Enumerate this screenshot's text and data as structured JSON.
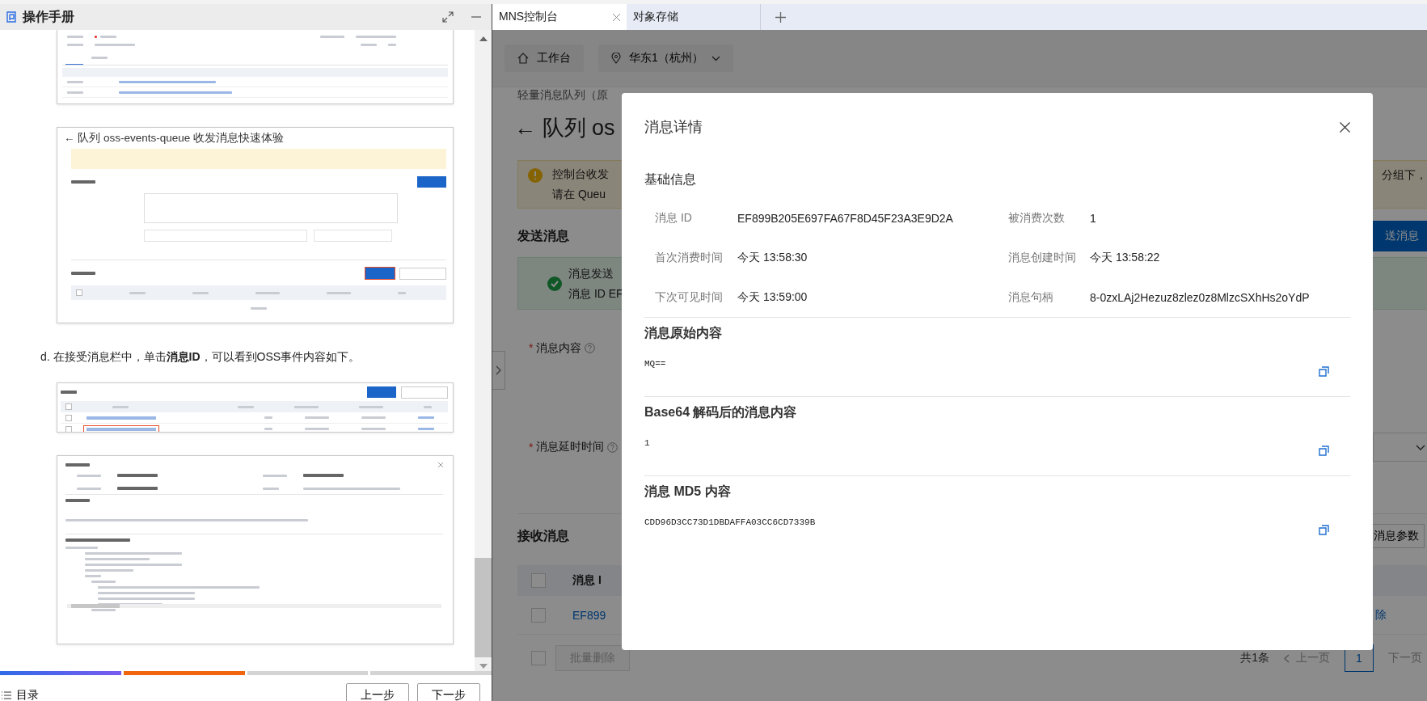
{
  "manual": {
    "title": "操作手册",
    "figure_quick_test": {
      "title": "← 队列 oss-events-queue 收发消息快速体验"
    },
    "paragraph": "d. 在接受消息栏中，单击**消息ID**，可以看到OSS事件内容如下。",
    "figure_receive": {
      "rows": [
        {
          "highlighted": false
        },
        {
          "highlighted": true
        }
      ]
    },
    "progress": [
      {
        "kind": "done"
      },
      {
        "kind": "current"
      },
      {
        "kind": "todo"
      },
      {
        "kind": "todo"
      }
    ],
    "toc": "目录",
    "buttons": [
      "上一步",
      "下一步"
    ]
  },
  "browser_tabs": [
    {
      "label": "MNS控制台",
      "selected": true
    },
    {
      "label": "对象存储",
      "selected": false
    }
  ],
  "toolbar": {
    "home": "工作台",
    "region": "华东1（杭州）"
  },
  "background_page": {
    "breadcrumb": "轻量消息队列（原",
    "heading": "← 队列 os",
    "warning_left": [
      "控制台收发",
      "请在 Queu"
    ],
    "warning_right": "分组下，",
    "send_title": "发送消息",
    "send_button": "送消息",
    "success_lines": [
      "消息发送",
      "消息 ID EF"
    ],
    "content_field": {
      "mark": "*",
      "label": "消息内容"
    },
    "delay_field": {
      "mark": "*",
      "label": "消息延时时间"
    },
    "receive_title": "接收消息",
    "params_button": "消息参数",
    "table_header": "消息 I",
    "header_checked": false,
    "row": {
      "id": "EF899",
      "action": "除",
      "checked": false
    },
    "footer_checked": false,
    "batch_delete": "批量删除",
    "pagination": {
      "total": "共1条",
      "prev": "上一页",
      "page": "1",
      "next": "下一页"
    }
  },
  "dialog": {
    "title": "消息详情",
    "basic_title": "基础信息",
    "fields": [
      {
        "label": "消息 ID",
        "value": "EF899B205E697FA67F8D45F23A3E9D2A"
      },
      {
        "label": "被消费次数",
        "value": "1"
      },
      {
        "label": "首次消费时间",
        "value": "今天 13:58:30"
      },
      {
        "label": "消息创建时间",
        "value": "今天 13:58:22"
      },
      {
        "label": "下次可见时间",
        "value": "今天 13:59:00"
      },
      {
        "label": "消息句柄",
        "value": "8-0zxLAj2Hezuz8zlez0z8MlzcSXhHs2oYdP"
      }
    ],
    "sections": [
      {
        "title": "消息原始内容",
        "content": "MQ=="
      },
      {
        "title": "Base64 解码后的消息内容",
        "content": "1"
      },
      {
        "title": "消息 MD5 内容",
        "content": "CDD96D3CC73D1DBDAFFA03CC6CD7339B"
      }
    ]
  }
}
